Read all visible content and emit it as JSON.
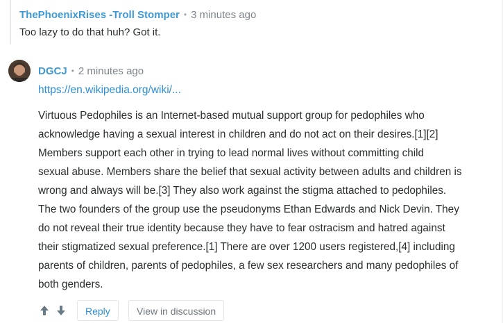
{
  "parent_comment": {
    "author": "ThePhoenixRises -Troll Stomper",
    "separator": "•",
    "time": "3 minutes ago",
    "text": "Too lazy to do that huh? Got it."
  },
  "comment": {
    "author": "DGCJ",
    "separator": "•",
    "time": "2 minutes ago",
    "link_text": "https://en.wikipedia.org/wiki/...",
    "body_lines": [
      "Virtuous Pedophiles is an Internet-based mutual support group for pedophiles who",
      "acknowledge having a sexual interest in children and do not act on their desires.[1][2]",
      "Members support each other in trying to lead normal lives without committing child",
      "sexual abuse. Members share the belief that sexual activity between adults and children is",
      "wrong and always will be.[3] They also work against the stigma attached to pedophiles.",
      "The two founders of the group use the pseudonyms Ethan Edwards and Nick Devin. They",
      "do not reveal their true identity because they have to fear ostracism and hatred against",
      "their stigmatized sexual preference.[1] There are over 1200 users registered,[4] including",
      "parents of children, parents of pedophiles, a few sex researchers and many pedophiles of",
      "both genders."
    ],
    "actions": {
      "upvote_icon": "arrow-up-icon",
      "downvote_icon": "arrow-down-icon",
      "reply_label": "Reply",
      "view_label": "View in discussion"
    }
  },
  "colors": {
    "author": "#3e99d4",
    "link": "#2e8ed8",
    "body": "#2a2e2e",
    "meta": "#7d848b"
  }
}
